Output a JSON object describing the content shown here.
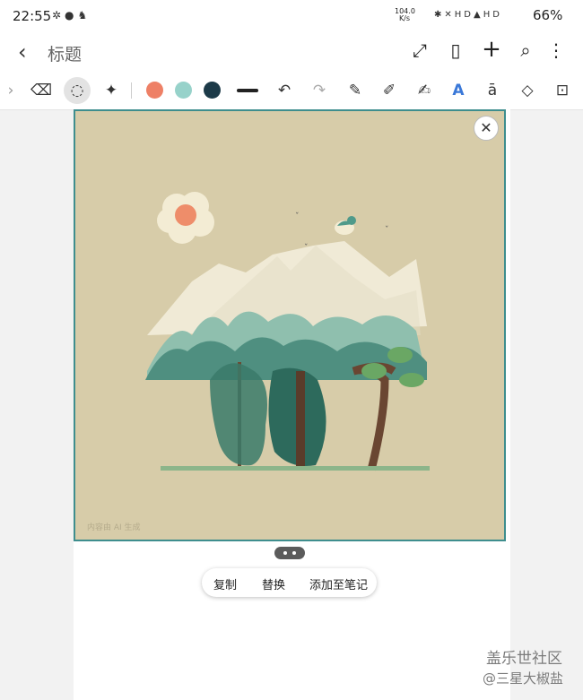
{
  "status": {
    "time": "22:55",
    "net_speed": "104.0",
    "net_unit": "K/s",
    "hd1": "HD",
    "hd2": "HD",
    "battery": "66%"
  },
  "appbar": {
    "title": "标题"
  },
  "toolbar": {
    "colors": [
      "#ee8066",
      "#97d2ca",
      "#1c3a48"
    ]
  },
  "context_menu": {
    "copy": "复制",
    "replace": "替换",
    "add_to_note": "添加至笔记"
  },
  "image": {
    "watermark": "内容由 AI 生成"
  },
  "watermark": {
    "community": "盖乐世社区",
    "user": "@三星大椒盐"
  }
}
